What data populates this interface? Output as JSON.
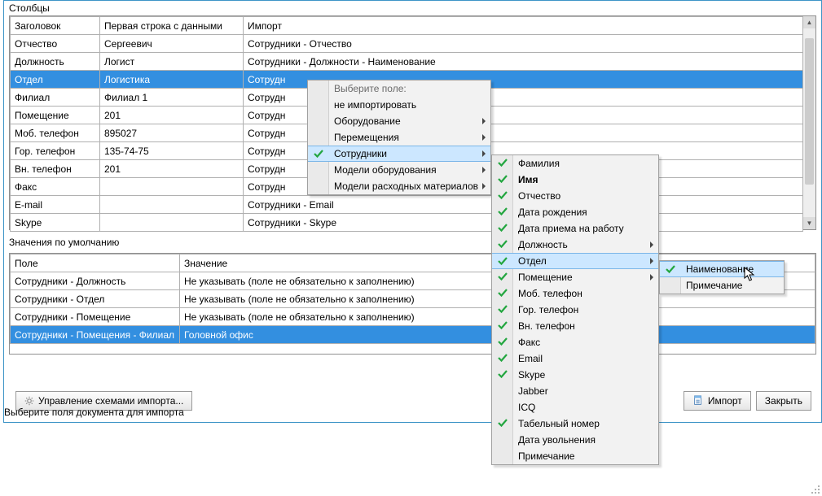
{
  "labels": {
    "columnsSection": "Столбцы",
    "defaultsSection": "Значения по умолчанию",
    "status": "Выберите поля документа для импорта",
    "manageSchemes": "Управление схемами импорта...",
    "import": "Импорт",
    "close": "Закрыть"
  },
  "columns": {
    "headers": {
      "h1": "Заголовок",
      "h2": "Первая строка с данными",
      "h3": "Импорт"
    },
    "rows": [
      {
        "c1": "Отчество",
        "c2": "Сергеевич",
        "c3": "Сотрудники - Отчество",
        "selected": false
      },
      {
        "c1": "Должность",
        "c2": "Логист",
        "c3": "Сотрудники - Должности - Наименование",
        "selected": false
      },
      {
        "c1": "Отдел",
        "c2": "Логистика",
        "c3": "Сотрудн",
        "selected": true
      },
      {
        "c1": "Филиал",
        "c2": "Филиал 1",
        "c3": "Сотрудн",
        "selected": false
      },
      {
        "c1": "Помещение",
        "c2": "201",
        "c3": "Сотрудн",
        "selected": false
      },
      {
        "c1": "Моб. телефон",
        "c2": "895027",
        "c3": "Сотрудн",
        "selected": false
      },
      {
        "c1": "Гор. телефон",
        "c2": "135-74-75",
        "c3": "Сотрудн",
        "selected": false
      },
      {
        "c1": "Вн. телефон",
        "c2": "201",
        "c3": "Сотрудн",
        "selected": false
      },
      {
        "c1": "Факс",
        "c2": "",
        "c3": "Сотрудн",
        "selected": false
      },
      {
        "c1": "E-mail",
        "c2": "",
        "c3": "Сотрудники - Email",
        "selected": false
      },
      {
        "c1": "Skype",
        "c2": "",
        "c3": "Сотрудники - Skype",
        "selected": false
      }
    ]
  },
  "defaults": {
    "headers": {
      "h1": "Поле",
      "h2": "Значение"
    },
    "rows": [
      {
        "c1": "Сотрудники - Должность",
        "c2": "Не указывать (поле не обязательно к заполнению)",
        "selected": false
      },
      {
        "c1": "Сотрудники - Отдел",
        "c2": "Не указывать (поле не обязательно к заполнению)",
        "selected": false
      },
      {
        "c1": "Сотрудники - Помещение",
        "c2": "Не указывать (поле не обязательно к заполнению)",
        "selected": false
      },
      {
        "c1": "Сотрудники - Помещения - Филиал",
        "c2": "Головной офис",
        "selected": true
      }
    ]
  },
  "menu1": {
    "header": "Выберите поле:",
    "items": [
      {
        "label": "не импортировать",
        "arrow": false,
        "checked": false,
        "hover": false
      },
      {
        "label": "Оборудование",
        "arrow": true,
        "checked": false,
        "hover": false
      },
      {
        "label": "Перемещения",
        "arrow": true,
        "checked": false,
        "hover": false
      },
      {
        "label": "Сотрудники",
        "arrow": true,
        "checked": true,
        "hover": true
      },
      {
        "label": "Модели оборудования",
        "arrow": true,
        "checked": false,
        "hover": false
      },
      {
        "label": "Модели расходных материалов",
        "arrow": true,
        "checked": false,
        "hover": false
      }
    ]
  },
  "menu2": {
    "items": [
      {
        "label": "Фамилия",
        "arrow": false,
        "checked": true,
        "hover": false,
        "bold": false
      },
      {
        "label": "Имя",
        "arrow": false,
        "checked": true,
        "hover": false,
        "bold": true
      },
      {
        "label": "Отчество",
        "arrow": false,
        "checked": true,
        "hover": false,
        "bold": false
      },
      {
        "label": "Дата рождения",
        "arrow": false,
        "checked": true,
        "hover": false,
        "bold": false
      },
      {
        "label": "Дата приема на работу",
        "arrow": false,
        "checked": true,
        "hover": false,
        "bold": false
      },
      {
        "label": "Должность",
        "arrow": true,
        "checked": true,
        "hover": false,
        "bold": false
      },
      {
        "label": "Отдел",
        "arrow": true,
        "checked": true,
        "hover": true,
        "bold": false
      },
      {
        "label": "Помещение",
        "arrow": true,
        "checked": true,
        "hover": false,
        "bold": false
      },
      {
        "label": "Моб. телефон",
        "arrow": false,
        "checked": true,
        "hover": false,
        "bold": false
      },
      {
        "label": "Гор. телефон",
        "arrow": false,
        "checked": true,
        "hover": false,
        "bold": false
      },
      {
        "label": "Вн. телефон",
        "arrow": false,
        "checked": true,
        "hover": false,
        "bold": false
      },
      {
        "label": "Факс",
        "arrow": false,
        "checked": true,
        "hover": false,
        "bold": false
      },
      {
        "label": "Email",
        "arrow": false,
        "checked": true,
        "hover": false,
        "bold": false
      },
      {
        "label": "Skype",
        "arrow": false,
        "checked": true,
        "hover": false,
        "bold": false
      },
      {
        "label": "Jabber",
        "arrow": false,
        "checked": false,
        "hover": false,
        "bold": false
      },
      {
        "label": "ICQ",
        "arrow": false,
        "checked": false,
        "hover": false,
        "bold": false
      },
      {
        "label": "Табельный номер",
        "arrow": false,
        "checked": true,
        "hover": false,
        "bold": false
      },
      {
        "label": "Дата увольнения",
        "arrow": false,
        "checked": false,
        "hover": false,
        "bold": false
      },
      {
        "label": "Примечание",
        "arrow": false,
        "checked": false,
        "hover": false,
        "bold": false
      }
    ]
  },
  "menu3": {
    "items": [
      {
        "label": "Наименование",
        "arrow": false,
        "checked": true,
        "hover": true,
        "bold": false
      },
      {
        "label": "Примечание",
        "arrow": false,
        "checked": false,
        "hover": false,
        "bold": false
      }
    ]
  }
}
